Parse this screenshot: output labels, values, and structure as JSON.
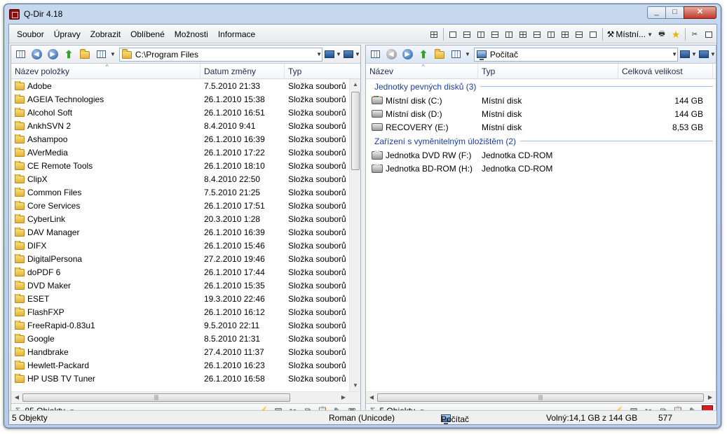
{
  "window": {
    "title": "Q-Dir 4.18",
    "min": "_",
    "max": "□",
    "close": "✕"
  },
  "menu": [
    "Soubor",
    "Úpravy",
    "Zobrazit",
    "Oblíbené",
    "Možnosti",
    "Informace"
  ],
  "quick": {
    "location_label": "Místní..."
  },
  "left": {
    "address": "C:\\Program Files",
    "columns": [
      "Název položky",
      "Datum změny",
      "Typ"
    ],
    "rows": [
      [
        "Adobe",
        "7.5.2010 21:33",
        "Složka souborů"
      ],
      [
        "AGEIA Technologies",
        "26.1.2010 15:38",
        "Složka souborů"
      ],
      [
        "Alcohol Soft",
        "26.1.2010 16:51",
        "Složka souborů"
      ],
      [
        "AnkhSVN 2",
        "8.4.2010 9:41",
        "Složka souborů"
      ],
      [
        "Ashampoo",
        "26.1.2010 16:39",
        "Složka souborů"
      ],
      [
        "AVerMedia",
        "26.1.2010 17:22",
        "Složka souborů"
      ],
      [
        "CE Remote Tools",
        "26.1.2010 18:10",
        "Složka souborů"
      ],
      [
        "ClipX",
        "8.4.2010 22:50",
        "Složka souborů"
      ],
      [
        "Common Files",
        "7.5.2010 21:25",
        "Složka souborů"
      ],
      [
        "Core Services",
        "26.1.2010 17:51",
        "Složka souborů"
      ],
      [
        "CyberLink",
        "20.3.2010 1:28",
        "Složka souborů"
      ],
      [
        "DAV Manager",
        "26.1.2010 16:39",
        "Složka souborů"
      ],
      [
        "DIFX",
        "26.1.2010 15:46",
        "Složka souborů"
      ],
      [
        "DigitalPersona",
        "27.2.2010 19:46",
        "Složka souborů"
      ],
      [
        "doPDF 6",
        "26.1.2010 17:44",
        "Složka souborů"
      ],
      [
        "DVD Maker",
        "26.1.2010 15:35",
        "Složka souborů"
      ],
      [
        "ESET",
        "19.3.2010 22:46",
        "Složka souborů"
      ],
      [
        "FlashFXP",
        "26.1.2010 16:12",
        "Složka souborů"
      ],
      [
        "FreeRapid-0.83u1",
        "9.5.2010 22:11",
        "Složka souborů"
      ],
      [
        "Google",
        "8.5.2010 21:31",
        "Složka souborů"
      ],
      [
        "Handbrake",
        "27.4.2010 11:37",
        "Složka souborů"
      ],
      [
        "Hewlett-Packard",
        "26.1.2010 16:23",
        "Složka souborů"
      ],
      [
        "HP USB TV Tuner",
        "26.1.2010 16:58",
        "Složka souborů"
      ]
    ],
    "count": "85 Objekty"
  },
  "right": {
    "address": "Počítač",
    "columns": [
      "Název",
      "Typ",
      "Celková velikost"
    ],
    "groups": [
      {
        "title": "Jednotky pevných disků (3)",
        "items": [
          [
            "Místní disk (C:)",
            "Místní disk",
            "144 GB"
          ],
          [
            "Místní disk (D:)",
            "Místní disk",
            "144 GB"
          ],
          [
            "RECOVERY (E:)",
            "Místní disk",
            "8,53 GB"
          ]
        ]
      },
      {
        "title": "Zařízení s vyměnitelným úložištěm (2)",
        "items": [
          [
            "Jednotka DVD RW (F:)",
            "Jednotka CD-ROM",
            ""
          ],
          [
            "Jednotka BD-ROM (H:)",
            "Jednotka CD-ROM",
            ""
          ]
        ]
      }
    ],
    "count": "5 Objekty"
  },
  "status": {
    "objects": "5 Objekty",
    "encoding": "Roman (Unicode)",
    "location": "Počítač",
    "free": "Volný:14,1 GB z 144 GB",
    "number": "577"
  }
}
